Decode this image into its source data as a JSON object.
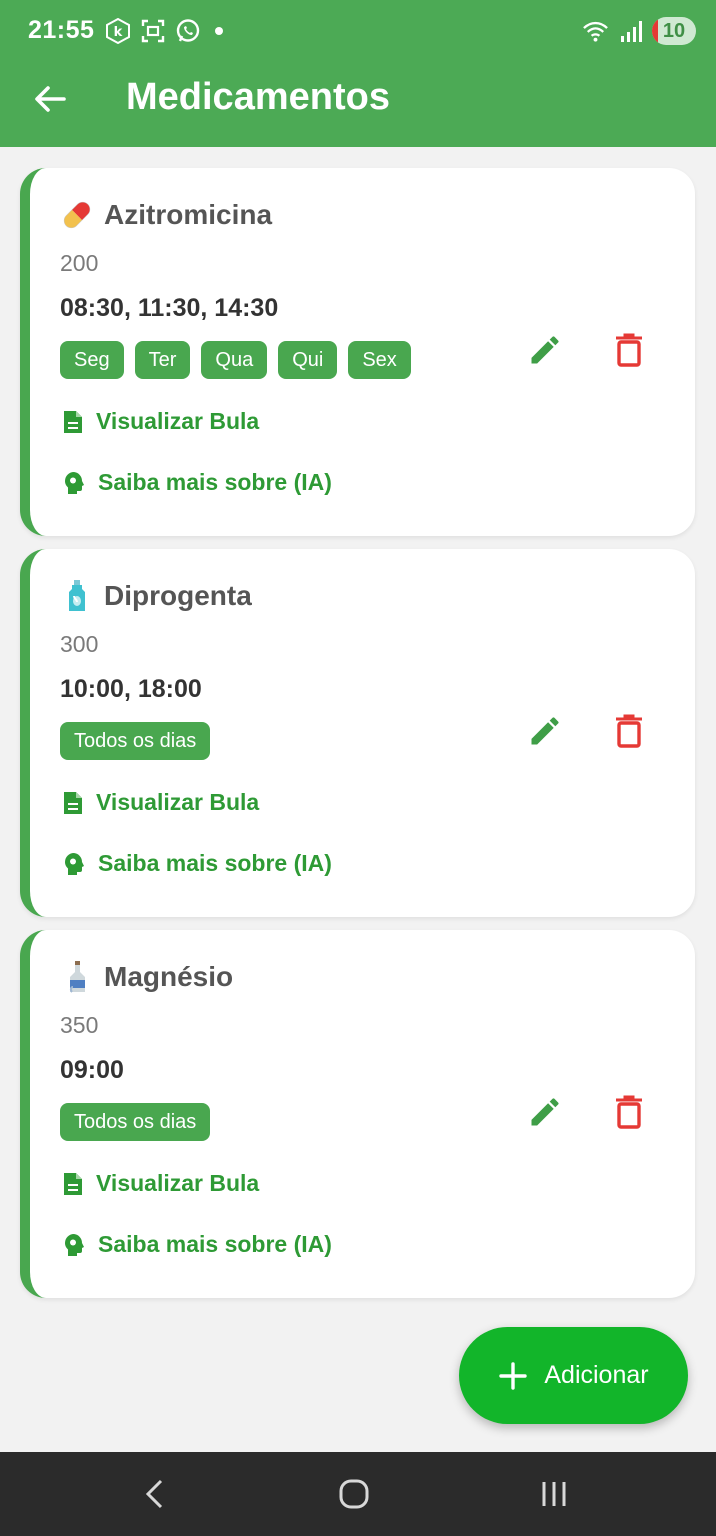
{
  "status_bar": {
    "time": "21:55",
    "battery": "10",
    "icons": [
      "k-circle-icon",
      "screenshot-icon",
      "whatsapp-icon",
      "dot-icon",
      "wifi-icon",
      "signal-icon",
      "battery-icon"
    ]
  },
  "header": {
    "title": "Medicamentos",
    "back_icon": "arrow-left-icon",
    "bg_color": "#4caa55"
  },
  "medications": [
    {
      "emoji": "pill-icon",
      "name": "Azitromicina",
      "dose": "200",
      "times": "08:30, 11:30, 14:30",
      "days": [
        "Seg",
        "Ter",
        "Qua",
        "Qui",
        "Sex"
      ],
      "link_bula": "Visualizar Bula",
      "link_ia": "Saiba mais sobre (IA)"
    },
    {
      "emoji": "lotion-bottle-icon",
      "name": "Diprogenta",
      "dose": "300",
      "times": "10:00, 18:00",
      "days": [
        "Todos os dias"
      ],
      "link_bula": "Visualizar Bula",
      "link_ia": "Saiba mais sobre (IA)"
    },
    {
      "emoji": "bottle-icon",
      "name": "Magnésio",
      "dose": "350",
      "times": "09:00",
      "days": [
        "Todos os dias"
      ],
      "link_bula": "Visualizar Bula",
      "link_ia": "Saiba mais sobre (IA)"
    }
  ],
  "fab": {
    "label": "Adicionar",
    "icon": "plus-icon",
    "color": "#12b52a"
  },
  "colors": {
    "accent": "#49a74f",
    "link": "#2e9a35",
    "delete": "#e53935"
  },
  "nav": [
    "back-nav-icon",
    "home-nav-icon",
    "recents-nav-icon"
  ]
}
